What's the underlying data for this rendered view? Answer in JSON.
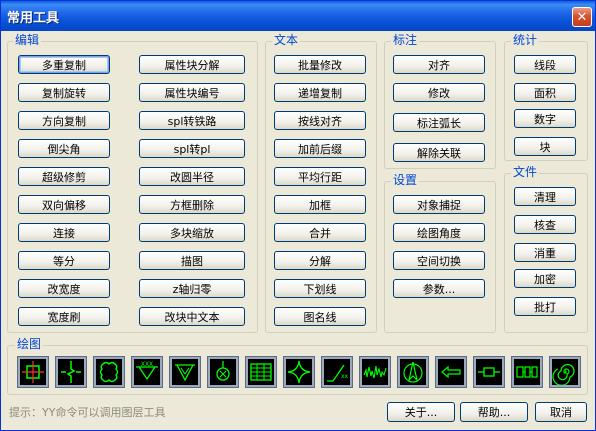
{
  "window": {
    "title": "常用工具",
    "close_glyph": "✕"
  },
  "groups": {
    "edit": {
      "label": "编辑",
      "buttons": [
        "多重复制",
        "复制旋转",
        "方向复制",
        "倒尖角",
        "超级修剪",
        "双向偏移",
        "连接",
        "等分",
        "改宽度",
        "宽度刷"
      ]
    },
    "edit2": {
      "buttons": [
        "属性块分解",
        "属性块编号",
        "spl转铁路",
        "spl转pl",
        "改圆半径",
        "方框删除",
        "多块缩放",
        "描图",
        "z轴归零",
        "改块中文本"
      ]
    },
    "text": {
      "label": "文本",
      "buttons": [
        "批量修改",
        "递增复制",
        "按线对齐",
        "加前后缀",
        "平均行距",
        "加框",
        "合并",
        "分解",
        "下划线",
        "图名线"
      ]
    },
    "annotate": {
      "label": "标注",
      "buttons": [
        "对齐",
        "修改",
        "标注弧长",
        "解除关联"
      ]
    },
    "settings": {
      "label": "设置",
      "buttons": [
        "对象捕捉",
        "绘图角度",
        "空间切换",
        "参数..."
      ]
    },
    "stats": {
      "label": "统计",
      "buttons": [
        "线段",
        "面积",
        "数字",
        "块"
      ]
    },
    "file": {
      "label": "文件",
      "buttons": [
        "清理",
        "核查",
        "消重",
        "加密",
        "批打"
      ]
    },
    "draw": {
      "label": "绘图",
      "icons": [
        "crosshair-box-icon",
        "break-line-icon",
        "cloud-outline-icon",
        "triangle-hatch-icon",
        "hatch-vee-icon",
        "circle-pin-icon",
        "grid-table-icon",
        "star-shape-icon",
        "diagonal-mark-icon",
        "zigzag-noise-icon",
        "north-arrow-icon",
        "arrow-left-icon",
        "resistor-icon",
        "segment-blocks-icon",
        "spiral-icon"
      ]
    }
  },
  "footer": {
    "hint": "提示：YY命令可以调用图层工具",
    "about": "关于...",
    "help": "帮助...",
    "cancel": "取消"
  },
  "colors": {
    "title_bar": "#0A5FE0",
    "group_label": "#0046D5",
    "icon_stroke": "#00FF00",
    "icon_accent": "#FF3030"
  }
}
